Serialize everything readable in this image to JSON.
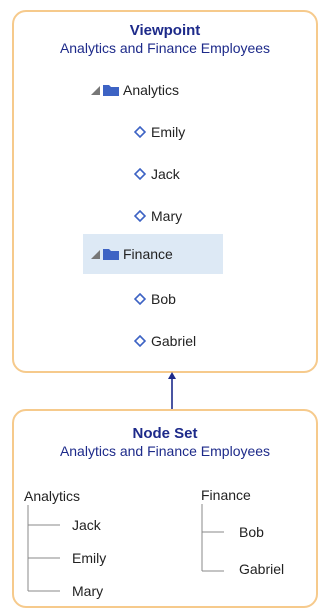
{
  "viewpoint": {
    "title": "Viewpoint",
    "subtitle": "Analytics and Finance Employees",
    "groups": [
      {
        "label": "Analytics",
        "members": [
          "Emily",
          "Jack",
          "Mary"
        ]
      },
      {
        "label": "Finance",
        "members": [
          "Bob",
          "Gabriel"
        ]
      }
    ]
  },
  "nodeset": {
    "title": "Node Set",
    "subtitle": "Analytics and Finance Employees",
    "analytics": {
      "label": "Analytics",
      "children": [
        "Jack",
        "Emily",
        "Mary"
      ]
    },
    "finance": {
      "label": "Finance",
      "children": [
        "Bob",
        "Gabriel"
      ]
    }
  },
  "colors": {
    "border": "#f6ca8c",
    "title": "#1d2a8a",
    "icon": "#3d63c4",
    "selected_row": "#dde9f5",
    "connector": "#1d2a8a"
  }
}
